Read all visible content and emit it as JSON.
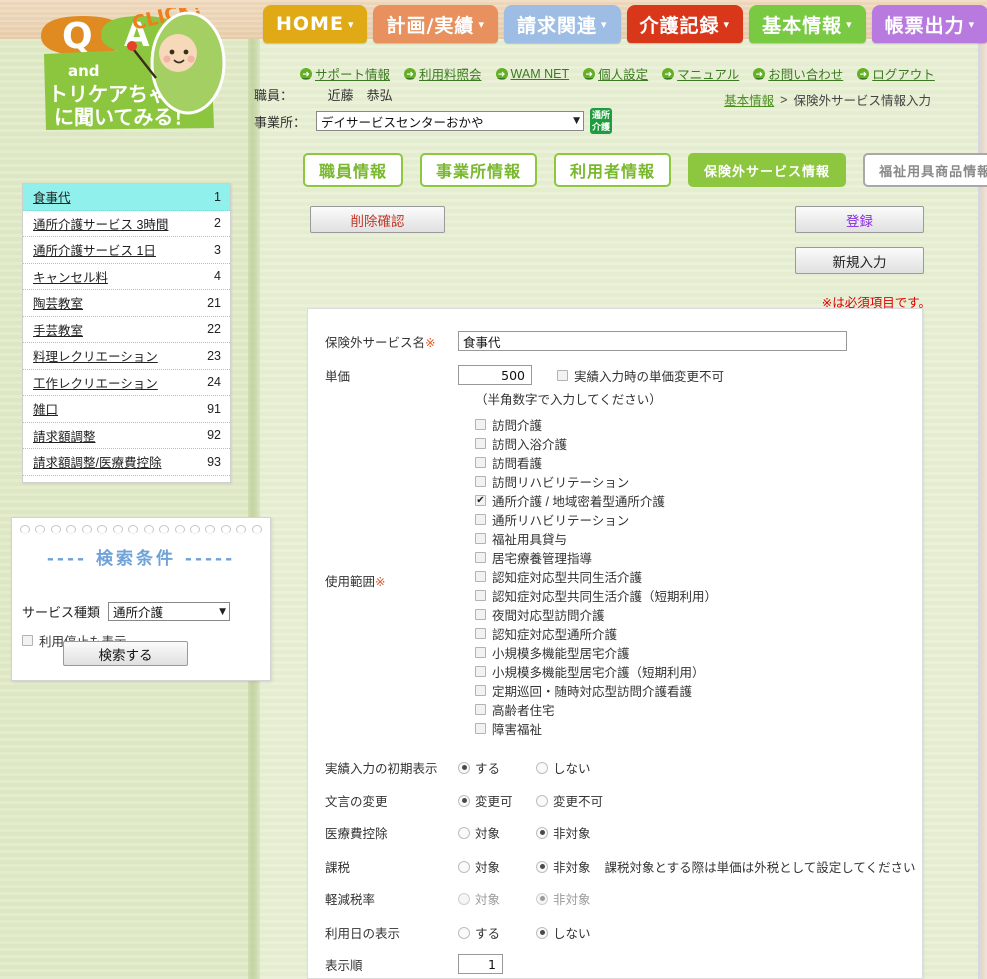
{
  "topnav": [
    {
      "label": "HOME",
      "caret": "▾",
      "color": "#dfaa16",
      "text": "#ffffff"
    },
    {
      "label": "計画/実績",
      "caret": "▾",
      "color": "#e8915e",
      "text": "#ffffff"
    },
    {
      "label": "請求関連",
      "caret": "▾",
      "color": "#9dbde4",
      "text": "#ffffff"
    },
    {
      "label": "介護記録",
      "caret": "▾",
      "color": "#d8371a",
      "text": "#ffffff"
    },
    {
      "label": "基本情報",
      "caret": "▾",
      "color": "#7ac943",
      "text": "#ffffff"
    },
    {
      "label": "帳票出力",
      "caret": "▾",
      "color": "#b97ae0",
      "text": "#ffffff"
    }
  ],
  "logo": {
    "q": "Q",
    "a": "A",
    "click": "CLICK!",
    "and": "and",
    "line1": "トリケアちゃん",
    "line2": "に聞いてみる！"
  },
  "utility_links": [
    {
      "label": "サポート情報",
      "icon": "arrow-circle-icon"
    },
    {
      "label": "利用料照会",
      "icon": "arrow-circle-icon"
    },
    {
      "label": "WAM NET",
      "icon": "arrow-circle-icon"
    },
    {
      "label": "個人設定",
      "icon": "arrow-circle-icon"
    },
    {
      "label": "マニュアル",
      "icon": "arrow-circle-icon"
    },
    {
      "label": "お問い合わせ",
      "icon": "arrow-circle-icon"
    },
    {
      "label": "ログアウト",
      "icon": "arrow-circle-icon"
    }
  ],
  "header": {
    "staff_label": "職員：",
    "staff_name": "近藤　恭弘",
    "office_label": "事業所：",
    "office_value": "デイサービスセンターおかや",
    "office_badge_line1": "通所",
    "office_badge_line2": "介護"
  },
  "breadcrumb": {
    "parent": "基本情報",
    "separator": ">",
    "current": "保険外サービス情報入力"
  },
  "section_tabs": [
    {
      "label": "職員情報",
      "state": "idle"
    },
    {
      "label": "事業所情報",
      "state": "idle"
    },
    {
      "label": "利用者情報",
      "state": "idle"
    },
    {
      "label": "保険外サービス情報",
      "state": "active"
    },
    {
      "label": "福祉用具商品情報",
      "state": "gray"
    }
  ],
  "actions": {
    "delete_confirm": "削除確認",
    "register": "登録",
    "new_input": "新規入力"
  },
  "required_note": "※は必須項目です。",
  "service_list": {
    "rows": [
      {
        "name": "食事代",
        "no": "1",
        "selected": true
      },
      {
        "name": "通所介護サービス 3時間",
        "no": "2",
        "selected": false
      },
      {
        "name": "通所介護サービス 1日",
        "no": "3",
        "selected": false
      },
      {
        "name": "キャンセル料",
        "no": "4",
        "selected": false
      },
      {
        "name": "陶芸教室",
        "no": "21",
        "selected": false
      },
      {
        "name": "手芸教室",
        "no": "22",
        "selected": false
      },
      {
        "name": "料理レクリエーション",
        "no": "23",
        "selected": false
      },
      {
        "name": "工作レクリエーション",
        "no": "24",
        "selected": false
      },
      {
        "name": "雑口",
        "no": "91",
        "selected": false
      },
      {
        "name": "請求額調整",
        "no": "92",
        "selected": false
      },
      {
        "name": "請求額調整/医療費控除",
        "no": "93",
        "selected": false
      }
    ]
  },
  "search_panel": {
    "title": "---- 検索条件 -----",
    "service_type_label": "サービス種類",
    "service_type_value": "通所介護",
    "show_stopped_label": "利用停止も表示",
    "show_stopped_checked": false,
    "search_button": "検索する"
  },
  "form": {
    "service_name": {
      "label": "保険外サービス名",
      "required_mark": "※",
      "value": "食事代"
    },
    "unit_price": {
      "label": "単価",
      "value": "500",
      "lock_checkbox_label": "実績入力時の単価変更不可",
      "lock_checked": false,
      "note": "（半角数字で入力してください）"
    },
    "usage_range": {
      "label": "使用範囲",
      "required_mark": "※",
      "items": [
        {
          "label": "訪問介護",
          "checked": false
        },
        {
          "label": "訪問入浴介護",
          "checked": false
        },
        {
          "label": "訪問看護",
          "checked": false
        },
        {
          "label": "訪問リハビリテーション",
          "checked": false
        },
        {
          "label": "通所介護 / 地域密着型通所介護",
          "checked": true
        },
        {
          "label": "通所リハビリテーション",
          "checked": false
        },
        {
          "label": "福祉用具貸与",
          "checked": false
        },
        {
          "label": "居宅療養管理指導",
          "checked": false
        },
        {
          "label": "認知症対応型共同生活介護",
          "checked": false
        },
        {
          "label": "認知症対応型共同生活介護（短期利用）",
          "checked": false
        },
        {
          "label": "夜間対応型訪問介護",
          "checked": false
        },
        {
          "label": "認知症対応型通所介護",
          "checked": false
        },
        {
          "label": "小規模多機能型居宅介護",
          "checked": false
        },
        {
          "label": "小規模多機能型居宅介護（短期利用）",
          "checked": false
        },
        {
          "label": "定期巡回・随時対応型訪問介護看護",
          "checked": false
        },
        {
          "label": "高齢者住宅",
          "checked": false
        },
        {
          "label": "障害福祉",
          "checked": false
        }
      ]
    },
    "radio_rows": [
      {
        "label": "実績入力の初期表示",
        "options": [
          {
            "label": "する",
            "checked": true
          },
          {
            "label": "しない",
            "checked": false
          }
        ],
        "dim": false,
        "note": ""
      },
      {
        "label": "文言の変更",
        "options": [
          {
            "label": "変更可",
            "checked": true
          },
          {
            "label": "変更不可",
            "checked": false
          }
        ],
        "dim": false,
        "note": ""
      },
      {
        "label": "医療費控除",
        "options": [
          {
            "label": "対象",
            "checked": false
          },
          {
            "label": "非対象",
            "checked": true
          }
        ],
        "dim": false,
        "note": ""
      },
      {
        "label": "課税",
        "options": [
          {
            "label": "対象",
            "checked": false
          },
          {
            "label": "非対象",
            "checked": true
          }
        ],
        "dim": false,
        "note": "課税対象とする際は単価は外税として設定してください"
      },
      {
        "label": "軽減税率",
        "options": [
          {
            "label": "対象",
            "checked": false
          },
          {
            "label": "非対象",
            "checked": true
          }
        ],
        "dim": true,
        "note": ""
      },
      {
        "label": "利用日の表示",
        "options": [
          {
            "label": "する",
            "checked": false
          },
          {
            "label": "しない",
            "checked": true
          }
        ],
        "dim": false,
        "note": ""
      }
    ],
    "display_order": {
      "label": "表示順",
      "value": "1"
    }
  }
}
